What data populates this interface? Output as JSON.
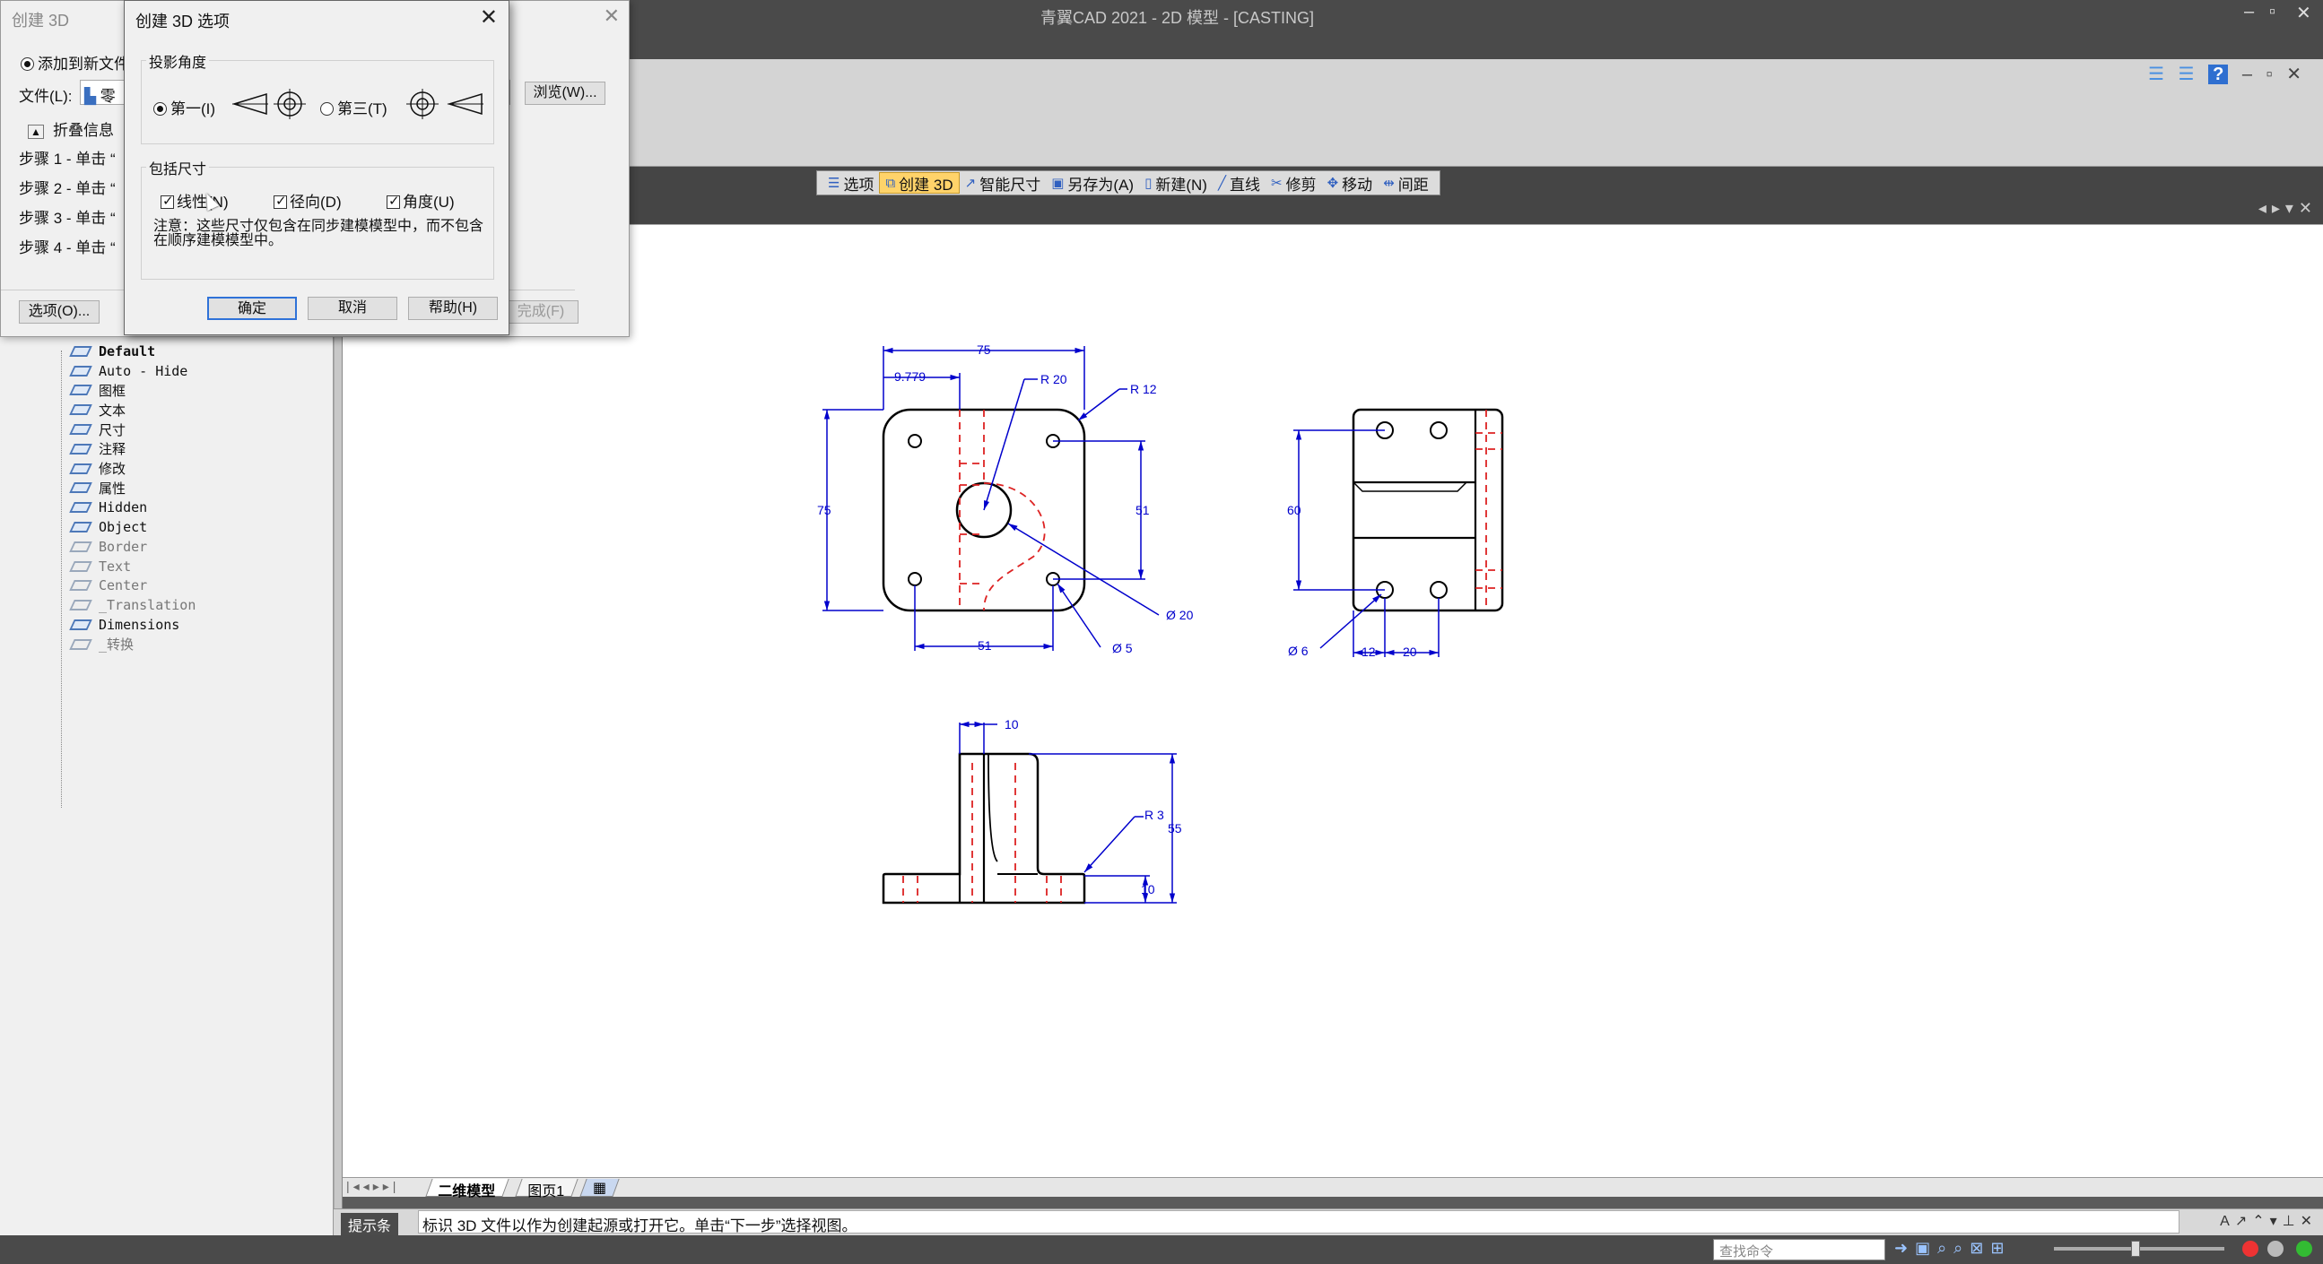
{
  "window": {
    "title": "青翼CAD 2021 - 2D 模型 - [CASTING]"
  },
  "ribbon": {
    "help": "?"
  },
  "commands": [
    {
      "label": "选项",
      "icon": "options-icon",
      "active": false
    },
    {
      "label": "创建 3D",
      "icon": "create-3d-icon",
      "active": true
    },
    {
      "label": "智能尺寸",
      "icon": "smart-dimension-icon",
      "active": false
    },
    {
      "label": "另存为(A)",
      "icon": "save-as-icon",
      "active": false
    },
    {
      "label": "新建(N)",
      "icon": "new-doc-icon",
      "active": false
    },
    {
      "label": "直线",
      "icon": "line-icon",
      "active": false
    },
    {
      "label": "修剪",
      "icon": "trim-icon",
      "active": false
    },
    {
      "label": "移动",
      "icon": "move-icon",
      "active": false
    },
    {
      "label": "间距",
      "icon": "spacing-icon",
      "active": false
    }
  ],
  "wizard": {
    "title": "创建 3D",
    "add_to_new_file": "添加到新文件",
    "file_label": "文件(L):",
    "file_value": "零",
    "browse": "浏览(W)...",
    "collapse_info": "折叠信息",
    "steps": [
      "步骤 1 - 单击 “",
      "步骤 2 - 单击 “",
      "步骤 3 - 单击 “",
      "步骤 4 - 单击 “"
    ],
    "options_button": "选项(O)...",
    "finish_button": "完成(F)"
  },
  "dialog": {
    "title": "创建 3D 选项",
    "projection_group": "投影角度",
    "first_angle": "第一(I)",
    "third_angle": "第三(T)",
    "include_dims_group": "包括尺寸",
    "linear": "线性(N)",
    "radial": "径向(D)",
    "angular": "角度(U)",
    "note": "注意：这些尺寸仅包含在同步建模模型中，而不包含在顺序建模模型中。",
    "ok": "确定",
    "cancel": "取消",
    "help": "帮助(H)"
  },
  "layers": [
    {
      "name": "Default",
      "style": "bold"
    },
    {
      "name": "Auto - Hide",
      "style": "normal"
    },
    {
      "name": "图框",
      "style": "normal"
    },
    {
      "name": "文本",
      "style": "normal"
    },
    {
      "name": "尺寸",
      "style": "normal"
    },
    {
      "name": "注释",
      "style": "normal"
    },
    {
      "name": "修改",
      "style": "normal"
    },
    {
      "name": "属性",
      "style": "normal"
    },
    {
      "name": "Hidden",
      "style": "normal"
    },
    {
      "name": "Object",
      "style": "normal"
    },
    {
      "name": "Border",
      "style": "dim"
    },
    {
      "name": "Text",
      "style": "dim"
    },
    {
      "name": "Center",
      "style": "dim"
    },
    {
      "name": "_Translation",
      "style": "dim"
    },
    {
      "name": "Dimensions",
      "style": "normal"
    },
    {
      "name": "_转换",
      "style": "dim"
    }
  ],
  "drawing": {
    "dims": {
      "top_width": "75",
      "offset": "9.779",
      "r20": "R 20",
      "r12": "R 12",
      "left_height": "75",
      "right_height": "51",
      "bottom_width": "51",
      "dia20": "Ø 20",
      "dia5": "Ø 5",
      "side_height": "60",
      "side_dia6": "Ø 6",
      "side_12": "12",
      "side_20": "20",
      "front_10": "10",
      "front_r3": "R 3",
      "front_55": "55",
      "front_10b": "10"
    }
  },
  "sheet_tabs": [
    "二维模型",
    "图页1"
  ],
  "prompt": {
    "label": "提示条",
    "text": "标识 3D 文件以作为创建起源或打开它。单击“下一步”选择视图。"
  },
  "status": {
    "search_placeholder": "查找命令"
  }
}
